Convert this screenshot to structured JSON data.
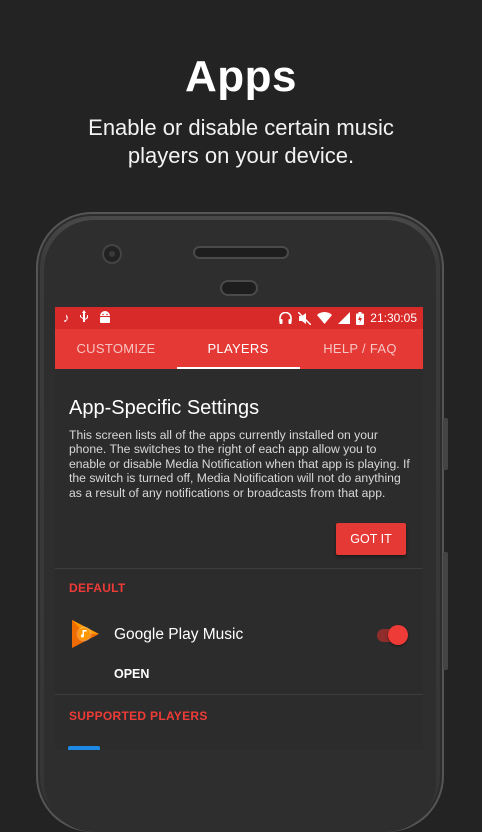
{
  "hero": {
    "title": "Apps",
    "subtitle": "Enable or disable certain music players on your device."
  },
  "statusbar": {
    "left_icons": [
      "music-note-icon",
      "usb-icon",
      "android-icon"
    ],
    "right_icons": [
      "headphones-icon",
      "mute-icon",
      "wifi-icon",
      "signal-icon",
      "battery-charging-icon"
    ],
    "time": "21:30:05",
    "color": "#d92a2a"
  },
  "tabs": [
    {
      "label": "CUSTOMIZE",
      "active": false
    },
    {
      "label": "PLAYERS",
      "active": true
    },
    {
      "label": "HELP / FAQ",
      "active": false
    }
  ],
  "card": {
    "title": "App-Specific Settings",
    "body": "This screen lists all of the apps currently installed on your phone. The switches to the right of each app allow you to enable or disable Media Notification when that app is playing. If the switch is turned off, Media Notification will not do anything as a result of any notifications or broadcasts from that app.",
    "button": "GOT IT"
  },
  "sections": {
    "default_label": "DEFAULT",
    "supported_label": "SUPPORTED PLAYERS"
  },
  "default_app": {
    "name": "Google Play Music",
    "icon": "google-play-music-icon",
    "enabled": true,
    "action": "OPEN"
  },
  "colors": {
    "accent": "#e53935",
    "background": "#232323",
    "screen": "#2c2c2c"
  }
}
